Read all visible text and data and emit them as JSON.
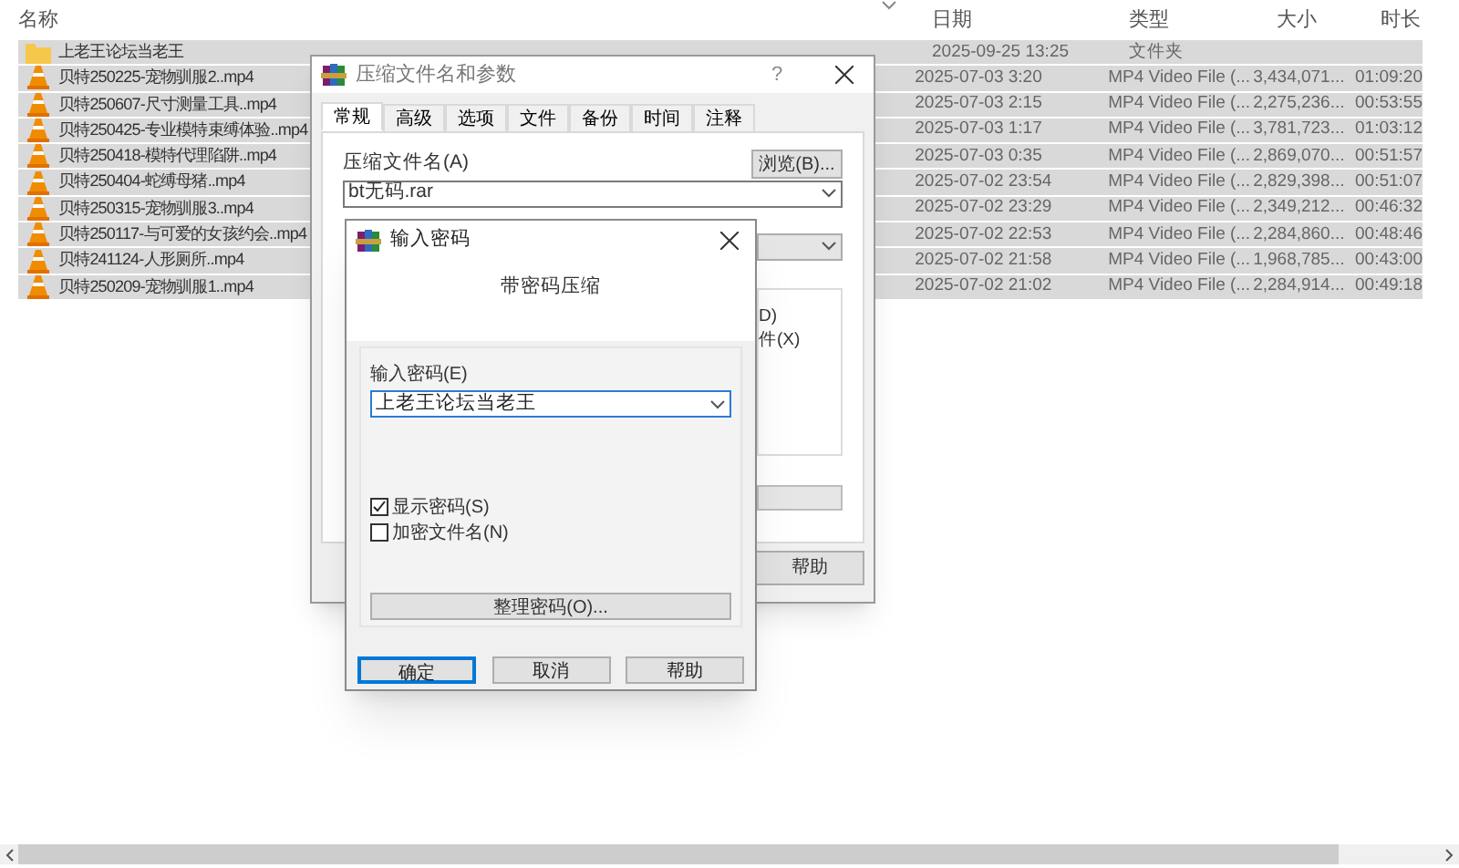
{
  "file_list": {
    "columns": [
      {
        "label": "名称"
      },
      {
        "label": "日期",
        "sorted": true
      },
      {
        "label": "类型"
      },
      {
        "label": "大小"
      },
      {
        "label": "时长"
      }
    ],
    "rows": [
      {
        "kind": "folder",
        "selected": true,
        "name": "上老王论坛当老王",
        "date": "2025-09-25 13:25",
        "type": "文件夹"
      },
      {
        "kind": "video",
        "selected": true,
        "name": "贝特250225-宠物驯服2..mp4",
        "date": "2025-07-03 3:20",
        "type": "MP4 Video File (...",
        "size": "3,434,071...",
        "duration": "01:09:20"
      },
      {
        "kind": "video",
        "selected": true,
        "name": "贝特250607-尺寸测量工具..mp4",
        "date": "2025-07-03 2:15",
        "type": "MP4 Video File (...",
        "size": "2,275,236...",
        "duration": "00:53:55"
      },
      {
        "kind": "video",
        "selected": true,
        "name": "贝特250425-专业模特束缚体验..mp4",
        "date": "2025-07-03 1:17",
        "type": "MP4 Video File (...",
        "size": "3,781,723...",
        "duration": "01:03:12"
      },
      {
        "kind": "video",
        "selected": true,
        "name": "贝特250418-模特代理陷阱..mp4",
        "date": "2025-07-03 0:35",
        "type": "MP4 Video File (...",
        "size": "2,869,070...",
        "duration": "00:51:57"
      },
      {
        "kind": "video",
        "selected": true,
        "name": "贝特250404-蛇缚母猪..mp4",
        "date": "2025-07-02 23:54",
        "type": "MP4 Video File (...",
        "size": "2,829,398...",
        "duration": "00:51:07"
      },
      {
        "kind": "video",
        "selected": true,
        "name": "贝特250315-宠物驯服3..mp4",
        "date": "2025-07-02 23:29",
        "type": "MP4 Video File (...",
        "size": "2,349,212...",
        "duration": "00:46:32"
      },
      {
        "kind": "video",
        "selected": true,
        "name": "贝特250117-与可爱的女孩约会..mp4",
        "date": "2025-07-02 22:53",
        "type": "MP4 Video File (...",
        "size": "2,284,860...",
        "duration": "00:48:46"
      },
      {
        "kind": "video",
        "selected": true,
        "name": "贝特241124-人形厕所..mp4",
        "date": "2025-07-02 21:58",
        "type": "MP4 Video File (...",
        "size": "1,968,785...",
        "duration": "00:43:00"
      },
      {
        "kind": "video",
        "selected": true,
        "name": "贝特250209-宠物驯服1..mp4",
        "date": "2025-07-02 21:02",
        "type": "MP4 Video File (...",
        "size": "2,284,914...",
        "duration": "00:49:18"
      }
    ]
  },
  "archive_dialog": {
    "title": "压缩文件名和参数",
    "help_glyph": "?",
    "tabs": [
      {
        "label": "常规",
        "selected": true
      },
      {
        "label": "高级",
        "selected": false
      },
      {
        "label": "选项",
        "selected": false
      },
      {
        "label": "文件",
        "selected": false
      },
      {
        "label": "备份",
        "selected": false
      },
      {
        "label": "时间",
        "selected": false
      },
      {
        "label": "注释",
        "selected": false
      }
    ],
    "filename_label": "压缩文件名(A)",
    "browse_button": "浏览(B)...",
    "filename_value": "bt无码.rar",
    "option_fragments": [
      "D)",
      "件(X)"
    ],
    "help_button": "帮助"
  },
  "password_dialog": {
    "title": "输入密码",
    "heading": "带密码压缩",
    "password_label": "输入密码(E)",
    "password_value": "上老王论坛当老王",
    "checkboxes": [
      {
        "label": "显示密码(S)",
        "checked": true
      },
      {
        "label": "加密文件名(N)",
        "checked": false
      }
    ],
    "organize_button": "整理密码(O)...",
    "buttons": [
      {
        "label": "确定",
        "default": true
      },
      {
        "label": "取消",
        "default": false
      },
      {
        "label": "帮助",
        "default": false
      }
    ]
  }
}
